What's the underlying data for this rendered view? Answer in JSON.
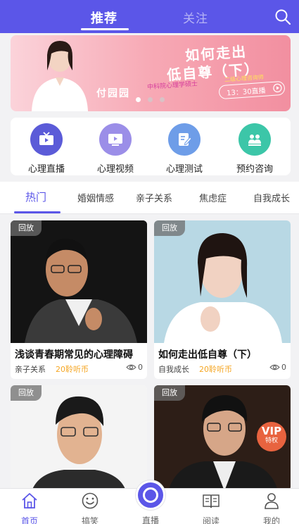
{
  "header": {
    "tab_recommend": "推荐",
    "tab_follow": "关注",
    "search_icon": "search-icon"
  },
  "banner": {
    "line1": "如何走出",
    "line2": "低自尊（下）",
    "sub1": "中科院心理学硕士",
    "sub2": "二级心理咨询师",
    "name": "付园园",
    "time": "13：30直播",
    "dots": 3,
    "active_dot": 0
  },
  "categories": [
    {
      "label": "心理直播",
      "icon": "tv-icon",
      "color": "#5b5bd8"
    },
    {
      "label": "心理视频",
      "icon": "video-icon",
      "color": "#9b8ee8"
    },
    {
      "label": "心理测试",
      "icon": "test-icon",
      "color": "#6e9de8"
    },
    {
      "label": "预约咨询",
      "icon": "people-icon",
      "color": "#3cc6a8"
    }
  ],
  "tabs": [
    "热门",
    "婚姻情感",
    "亲子关系",
    "焦虑症",
    "自我成长"
  ],
  "active_tab": 0,
  "cards": [
    {
      "badge": "回放",
      "title": "浅谈青春期常见的心理障碍",
      "tag": "亲子关系",
      "price": "20聆听币",
      "views": "0"
    },
    {
      "badge": "回放",
      "title": "如何走出低自尊（下）",
      "tag": "自我成长",
      "price": "20聆听币",
      "views": "0"
    },
    {
      "badge": "回放",
      "title": "",
      "tag": "",
      "price": "",
      "views": ""
    },
    {
      "badge": "回放",
      "vip": "VIP",
      "vip_sub": "特权",
      "title": "",
      "tag": "",
      "price": "",
      "views": ""
    }
  ],
  "nav": [
    {
      "label": "首页",
      "icon": "home-icon"
    },
    {
      "label": "搞笑",
      "icon": "smile-icon"
    },
    {
      "label": "直播",
      "icon": "live-icon"
    },
    {
      "label": "阅读",
      "icon": "book-icon"
    },
    {
      "label": "我的",
      "icon": "user-icon"
    }
  ],
  "colors": {
    "primary": "#5b56e8",
    "price": "#f5a623",
    "banner": "#f28fa0"
  }
}
